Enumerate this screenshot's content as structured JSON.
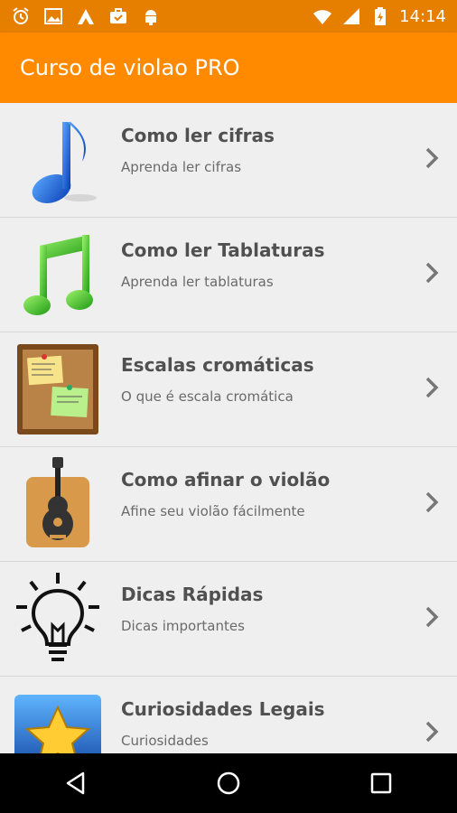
{
  "status_bar": {
    "time": "14:14",
    "left_icons": [
      "alarm-icon",
      "image-icon",
      "hiking-icon",
      "briefcase-icon",
      "android-icon"
    ],
    "right_icons": [
      "wifi-icon",
      "signal-icon",
      "battery-charging-icon"
    ]
  },
  "app_bar": {
    "title": "Curso de violao PRO",
    "color": "#ff8a00"
  },
  "list": {
    "items": [
      {
        "title": "Como ler cifras",
        "subtitle": "Aprenda ler cifras",
        "icon": "blue-music-note-icon"
      },
      {
        "title": "Como ler Tablaturas",
        "subtitle": "Aprenda ler tablaturas",
        "icon": "green-music-notes-icon"
      },
      {
        "title": "Escalas cromáticas",
        "subtitle": "O que é escala cromática",
        "icon": "corkboard-icon"
      },
      {
        "title": "Como afinar o violão",
        "subtitle": "Afine seu violão fácilmente",
        "icon": "guitar-icon"
      },
      {
        "title": "Dicas Rápidas",
        "subtitle": "Dicas importantes",
        "icon": "lightbulb-icon"
      },
      {
        "title": "Curiosidades Legais",
        "subtitle": "Curiosidades",
        "icon": "star-icon"
      }
    ]
  },
  "nav_bar": {
    "buttons": [
      "back-icon",
      "home-icon",
      "recents-icon"
    ]
  }
}
